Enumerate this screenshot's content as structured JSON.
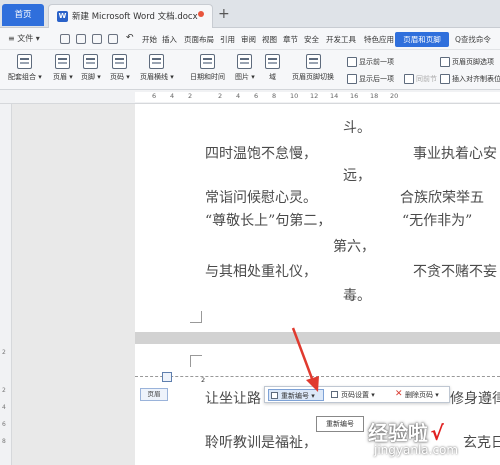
{
  "tabs": {
    "home": "首页",
    "doc_icon": "W",
    "doc_title": "新建 Microsoft Word 文档.docx"
  },
  "menu": {
    "file": "文件",
    "items": [
      "开始",
      "插入",
      "页面布局",
      "引用",
      "审阅",
      "视图",
      "章节",
      "安全",
      "开发工具",
      "特色应用"
    ],
    "active": "页眉和页脚",
    "search": "Q查找命令"
  },
  "ribbon": {
    "buttons": [
      "配套组合",
      "页眉",
      "页脚",
      "页码",
      "页眉横线",
      "日期和时间",
      "图片",
      "域",
      "页眉页脚切换"
    ],
    "small": [
      "显示前一项",
      "显示后一项",
      "同前节",
      "页眉页脚选项",
      "插入对齐制表位"
    ]
  },
  "ruler": [
    "6",
    "4",
    "2",
    "2",
    "4",
    "6",
    "8",
    "10",
    "12",
    "14",
    "16",
    "18",
    "20"
  ],
  "vruler": [
    "2",
    "2",
    "4",
    "6",
    "8"
  ],
  "page1_lines": [
    "斗。",
    "四时温饱不怠慢，",
    "事业执着心安",
    "远，",
    "常诣问候慰心灵。",
    "合族欣荣举五",
    "“尊敬长上”句第二，",
    "“无作非为”",
    "第六，",
    "与其相处重礼仪，",
    "不贪不赌不妄",
    "毒。"
  ],
  "page2_lines": [
    "让坐让路",
    "修身遵律",
    "聆听教训是福祉，",
    "玄克日"
  ],
  "page2_num": "2",
  "header_label": "页眉",
  "hf_toolbar": {
    "renumber": "重新编号",
    "page_settings": "页码设置",
    "delete": "删除页码"
  },
  "tooltip": "重新编号",
  "watermark": {
    "main": "经验啦",
    "check": "√",
    "sub": "jingyanla.com"
  },
  "colors": {
    "accent": "#2f6fdc",
    "arrow": "#e03a2f"
  }
}
